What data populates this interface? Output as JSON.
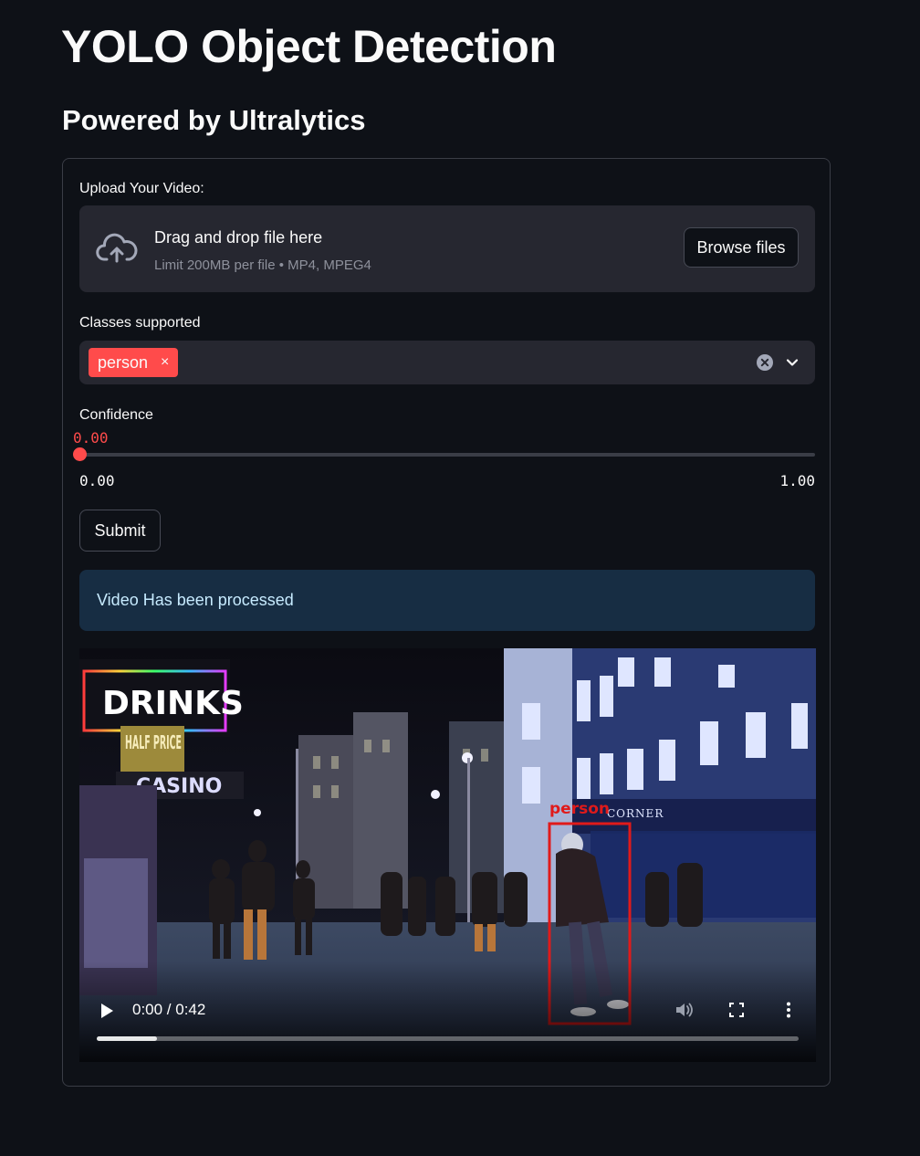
{
  "page": {
    "title": "YOLO Object Detection",
    "subtitle": "Powered by Ultralytics"
  },
  "uploader": {
    "label": "Upload Your Video:",
    "drag_text": "Drag and drop file here",
    "limit_text": "Limit 200MB per file • MP4, MPEG4",
    "browse_label": "Browse files",
    "icon": "cloud-upload-icon"
  },
  "classes": {
    "label": "Classes supported",
    "selected": [
      "person"
    ],
    "chip_remove": "×",
    "accent": "#ff4b4b"
  },
  "confidence": {
    "label": "Confidence",
    "value_text": "0.00",
    "value": 0.0,
    "min_text": "0.00",
    "max_text": "1.00",
    "min": 0.0,
    "max": 1.0
  },
  "submit": {
    "label": "Submit"
  },
  "alert": {
    "text": "Video Has been processed",
    "color": "#172d43"
  },
  "video": {
    "time_text": "0:00 / 0:42",
    "buffered_fraction": 0.086,
    "detection_label": "person",
    "detection_color": "#e01a1a",
    "scene_signs": {
      "drinks": "DRINKS",
      "half_price": "HALF PRICE",
      "casino": "CASINO",
      "corner": "CORNER"
    }
  }
}
